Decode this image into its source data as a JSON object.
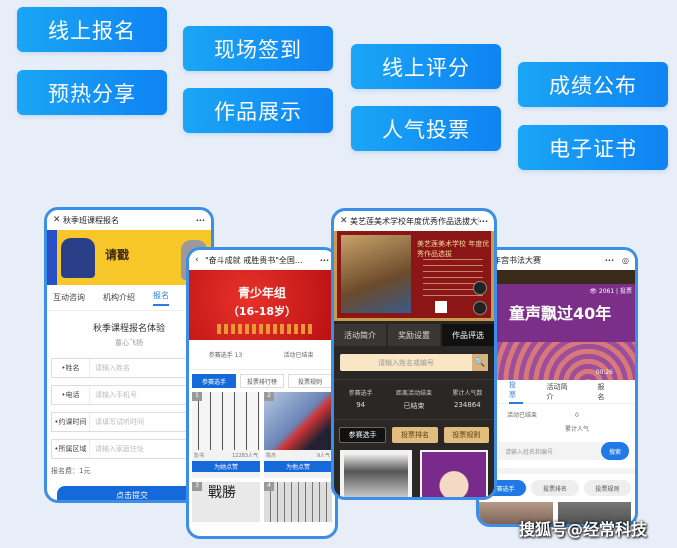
{
  "features": [
    {
      "label": "线上报名"
    },
    {
      "label": "预热分享"
    },
    {
      "label": "现场签到"
    },
    {
      "label": "作品展示"
    },
    {
      "label": "线上评分"
    },
    {
      "label": "人气投票"
    },
    {
      "label": "成绩公布"
    },
    {
      "label": "电子证书"
    }
  ],
  "phone1": {
    "close_icon": "✕",
    "title": "秋季班课程报名",
    "more_icon": "···",
    "banner_text": "请戳",
    "tabs": [
      {
        "label": "互动咨询"
      },
      {
        "label": "机构介绍"
      },
      {
        "label": "报名"
      }
    ],
    "form_title": "秋季课程报名体验",
    "form_subtitle": "童心飞扬",
    "fields": [
      {
        "label": "•姓名",
        "placeholder": "请输入姓名"
      },
      {
        "label": "•电话",
        "placeholder": "请输入手机号"
      },
      {
        "label": "•约课时间",
        "placeholder": "请填写试听时间"
      },
      {
        "label": "•所属区域",
        "placeholder": "请输入家庭住址"
      }
    ],
    "fee": "报名费：1元",
    "submit": "点击提交"
  },
  "phone2": {
    "back_icon": "‹",
    "title": "\"奋斗成就 戒胜贵书\"全国...",
    "more_icon": "···",
    "banner_line1": "青少年组",
    "banner_line2": "（16-18岁）",
    "stats": [
      {
        "label": "参赛选手 13"
      },
      {
        "label": "活动已结束"
      }
    ],
    "buttons": [
      {
        "label": "参赛选手"
      },
      {
        "label": "投票排行榜"
      },
      {
        "label": "投票规则"
      }
    ],
    "cards": [
      {
        "num": "1",
        "name": "彭书",
        "votes": "12283人气",
        "vote": "为她点赞"
      },
      {
        "num": "2",
        "name": "陈杰",
        "votes": "9人气",
        "vote": "为他点赞"
      }
    ],
    "cards_b": [
      {
        "num": "3",
        "text": "戰勝"
      },
      {
        "num": "4",
        "text": ""
      }
    ]
  },
  "phone3": {
    "close_icon": "✕",
    "title": "美艺莲美术学校年度优秀作品选拔大赛",
    "more_icon": "···",
    "banner_heading": "美艺莲美术学校 年度优秀作品选拔",
    "tabs": [
      {
        "label": "活动简介"
      },
      {
        "label": "奖励设置"
      },
      {
        "label": "作品评选"
      }
    ],
    "search_placeholder": "请输入姓名或编号",
    "search_icon": "🔍",
    "stats": [
      {
        "label": "参赛选手",
        "value": "94"
      },
      {
        "label": "距离活动结束",
        "value": "已结束"
      },
      {
        "label": "累计人气数",
        "value": "234864"
      }
    ],
    "buttons": [
      {
        "label": "参赛选手"
      },
      {
        "label": "投票排名"
      },
      {
        "label": "投票规则"
      }
    ]
  },
  "phone4": {
    "title": "少年宫书法大赛",
    "more_icon": "···",
    "target_icon": "◎",
    "banner_title": "童声飘过40年",
    "views": "👁 2061 | 投票",
    "time": "00:26",
    "tabs": [
      {
        "label": "投票"
      },
      {
        "label": "活动简介"
      },
      {
        "label": "报名"
      }
    ],
    "status": "活动已结束",
    "popularity_value": "0",
    "popularity_label": "累计人气",
    "search_placeholder": "请输入姓名和编号",
    "search_button": "搜索",
    "buttons": [
      {
        "label": "参赛选手"
      },
      {
        "label": "投票排名"
      },
      {
        "label": "投票规则"
      }
    ]
  },
  "watermark": "搜狐号@经常科技"
}
